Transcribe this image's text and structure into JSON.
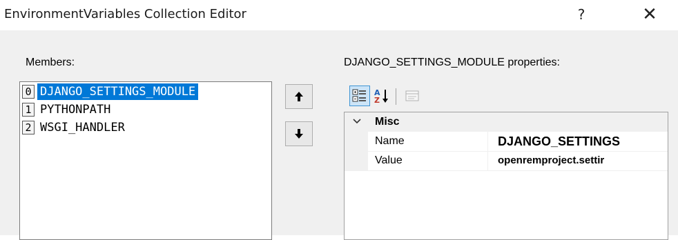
{
  "window": {
    "title": "EnvironmentVariables Collection Editor",
    "help_label": "?",
    "close_label": "✕"
  },
  "members": {
    "label": "Members:",
    "items": [
      {
        "index": "0",
        "name": "DJANGO_SETTINGS_MODULE",
        "selected": true
      },
      {
        "index": "1",
        "name": "PYTHONPATH",
        "selected": false
      },
      {
        "index": "2",
        "name": "WSGI_HANDLER",
        "selected": false
      }
    ],
    "move_up_icon": "arrow-up-icon",
    "move_down_icon": "arrow-down-icon"
  },
  "properties": {
    "label": "DJANGO_SETTINGS_MODULE properties:",
    "toolbar": {
      "categorized_icon": "categorized-icon",
      "alphabetical_icon": "alphabetical-sort-icon",
      "property_pages_icon": "property-pages-icon"
    },
    "grid": {
      "category": "Misc",
      "rows": [
        {
          "name": "Name",
          "value": "DJANGO_SETTINGS"
        },
        {
          "name": "Value",
          "value": "openremproject.settir"
        }
      ]
    }
  },
  "colors": {
    "selection": "#0078d7",
    "background": "#f0f0f0"
  }
}
